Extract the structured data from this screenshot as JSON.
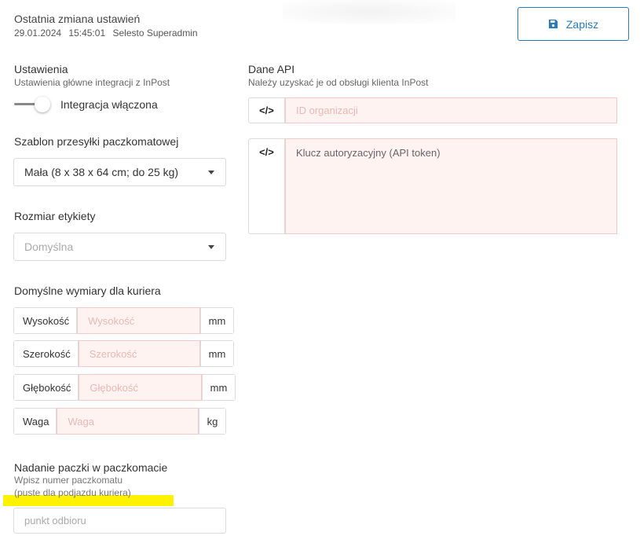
{
  "header": {
    "title": "Ostatnia zmiana ustawień",
    "date": "29.01.2024",
    "time": "15:45:01",
    "user": "Selesto Superadmin",
    "save_label": "Zapisz"
  },
  "settings": {
    "title": "Ustawienia",
    "subtitle": "Ustawienia główne integracji z InPost",
    "toggle_label": "Integracja włączona",
    "toggle_on": true
  },
  "parcel_template": {
    "title": "Szablon przesyłki paczkomatowej",
    "value": "Mała (8 x 38 x 64 cm; do 25 kg)"
  },
  "label_size": {
    "title": "Rozmiar etykiety",
    "placeholder": "Domyślna"
  },
  "courier_dims": {
    "title": "Domyślne wymiary dla kuriera",
    "rows": [
      {
        "label": "Wysokość",
        "placeholder": "Wysokość",
        "unit": "mm"
      },
      {
        "label": "Szerokość",
        "placeholder": "Szerokość",
        "unit": "mm"
      },
      {
        "label": "Głębokość",
        "placeholder": "Głębokość",
        "unit": "mm"
      },
      {
        "label": "Waga",
        "placeholder": "Waga",
        "unit": "kg"
      }
    ]
  },
  "parcel_locker": {
    "title": "Nadanie paczki w paczkomacie",
    "hint1": "Wpisz numer paczkomatu",
    "hint2": "(puste dla podjazdu kuriera)",
    "placeholder": "punkt odbioru"
  },
  "api": {
    "title": "Dane API",
    "subtitle": "Należy uzyskać je od obsługi klienta InPost",
    "code_icon": "</>",
    "org_placeholder": "ID organizacji",
    "token_placeholder": "Klucz autoryzacyjny (API token)"
  },
  "colors": {
    "accent": "#2a7ab8",
    "invalid_bg": "#fff3f2",
    "highlight": "#fff200"
  }
}
